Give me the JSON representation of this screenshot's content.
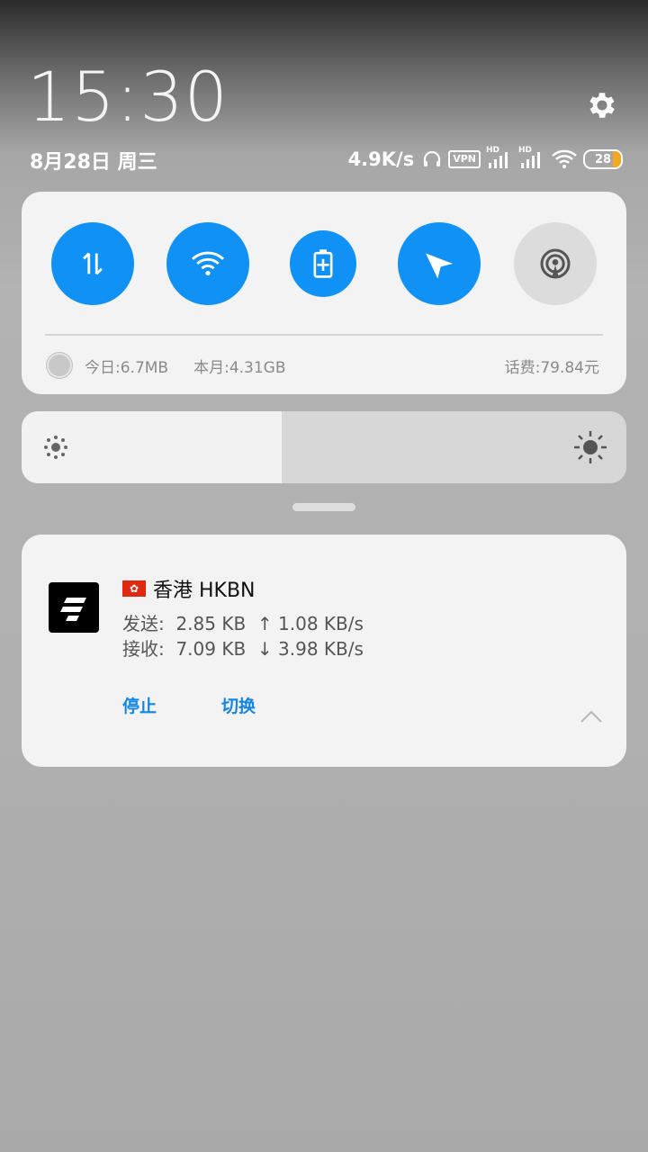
{
  "status_bar": {
    "time": "15:30",
    "date": "8月28日 周三",
    "net_speed": "4.9K/s",
    "vpn_label": "VPN",
    "hd_label_1": "HD",
    "hd_label_2": "HD",
    "battery_level": "28",
    "icons": [
      "settings-gear-icon",
      "headphones-icon",
      "vpn-icon",
      "signal-icon",
      "signal-icon",
      "wifi-icon",
      "battery-icon"
    ]
  },
  "quick_settings": {
    "toggles": [
      {
        "name": "mobile-data",
        "icon": "data-arrows-icon",
        "state": "on"
      },
      {
        "name": "wifi",
        "icon": "wifi-icon",
        "state": "on"
      },
      {
        "name": "battery-saver",
        "icon": "battery-plus-icon",
        "state": "on"
      },
      {
        "name": "location",
        "icon": "location-arrow-icon",
        "state": "on"
      },
      {
        "name": "hotspot",
        "icon": "hotspot-icon",
        "state": "off"
      }
    ],
    "usage": {
      "today": "今日:6.7MB",
      "month": "本月:4.31GB",
      "fee": "话费:79.84元"
    }
  },
  "brightness": {
    "level_percent": 43
  },
  "notification": {
    "title": "香港 HKBN",
    "sent_line": "发送:  2.85 KB  ↑ 1.08 KB/s",
    "recv_line": "接收:  7.09 KB  ↓ 3.98 KB/s",
    "action_stop": "停止",
    "action_switch": "切换",
    "accent_color": "#1386e4"
  },
  "colors": {
    "toggle_on": "#0f91f6",
    "toggle_off": "#dcdcdc"
  }
}
